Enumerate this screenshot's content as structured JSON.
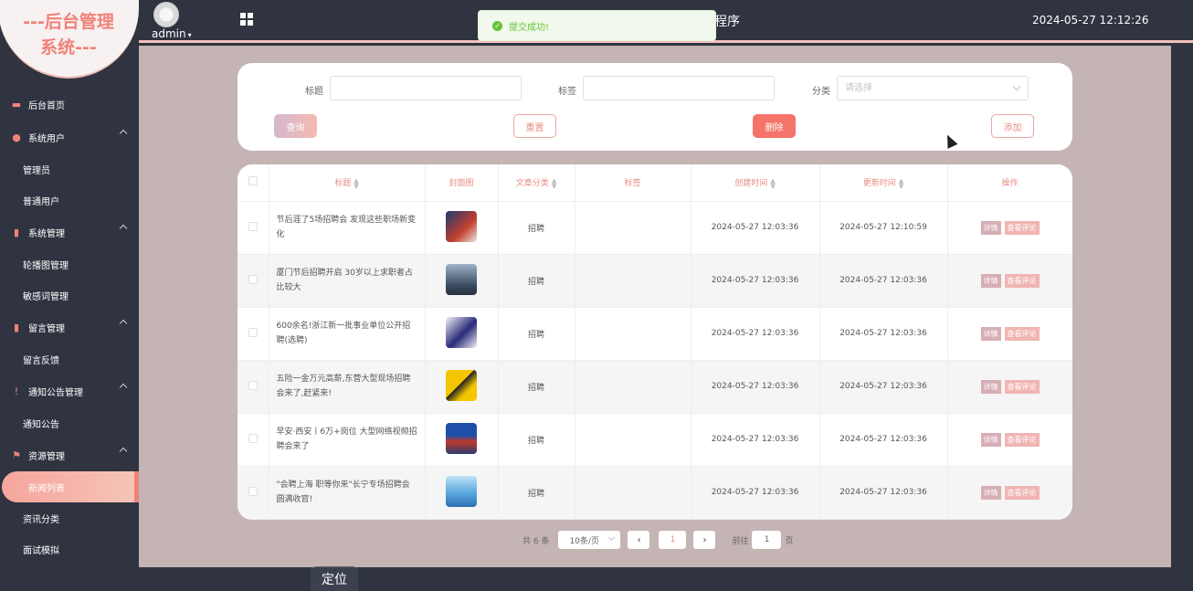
{
  "sidebar": {
    "brand_line1": "---后台管理",
    "brand_line2": "系统---",
    "menu": {
      "home": "后台首页",
      "users": "系统用户",
      "admin": "管理员",
      "normal_users": "普通用户",
      "system": "系统管理",
      "carousel": "轮播图管理",
      "sensitive": "敏感词管理",
      "messages": "留言管理",
      "feedback": "留言反馈",
      "notices": "通知公告管理",
      "notice": "通知公告",
      "resources": "资源管理",
      "news_list": "新闻列表",
      "news_category": "资讯分类",
      "interview": "面试模拟"
    }
  },
  "header": {
    "user": "admin",
    "app_title": "程序",
    "clock": "2024-05-27 12:12:26"
  },
  "toast": {
    "message": "提交成功!"
  },
  "search": {
    "title_label": "标题",
    "tag_label": "标签",
    "category_label": "分类",
    "category_placeholder": "请选择",
    "btn_query": "查询",
    "btn_reset": "重置",
    "btn_delete": "删除",
    "btn_add": "添加"
  },
  "table": {
    "headers": {
      "title": "标题",
      "cover": "封面图",
      "category": "文章分类",
      "tag": "标签",
      "created": "创建时间",
      "updated": "更新时间",
      "actions": "操作"
    },
    "action_detail": "详情",
    "action_comment": "查看评论",
    "rows": [
      {
        "title": "节后涯了5场招聘会 发现这些职场新变化",
        "category": "招聘",
        "tag": "",
        "created": "2024-05-27 12:03:36",
        "updated": "2024-05-27 12:10:59"
      },
      {
        "title": "厦门节后招聘开启 30岁以上求职者占比较大",
        "category": "招聘",
        "tag": "",
        "created": "2024-05-27 12:03:36",
        "updated": "2024-05-27 12:03:36"
      },
      {
        "title": "600余名!浙江新一批事业单位公开招聘(选聘)",
        "category": "招聘",
        "tag": "",
        "created": "2024-05-27 12:03:36",
        "updated": "2024-05-27 12:03:36"
      },
      {
        "title": "五险一金万元高薪,东营大型现场招聘会来了,赶紧来!",
        "category": "招聘",
        "tag": "",
        "created": "2024-05-27 12:03:36",
        "updated": "2024-05-27 12:03:36"
      },
      {
        "title": "早安·西安丨6万+岗位 大型网络视频招聘会来了",
        "category": "招聘",
        "tag": "",
        "created": "2024-05-27 12:03:36",
        "updated": "2024-05-27 12:03:36"
      },
      {
        "title": "\"会聘上海 职等你来\"长宁专场招聘会圆满收官!",
        "category": "招聘",
        "tag": "",
        "created": "2024-05-27 12:03:36",
        "updated": "2024-05-27 12:03:36"
      }
    ]
  },
  "pager": {
    "total": "共 6 条",
    "page_size": "10条/页",
    "current": "1",
    "goto_label": "前往",
    "goto_value": "1",
    "page_suffix": "页"
  },
  "footer_tab": "定位",
  "colors": {
    "accent": "#f08278",
    "sidebar": "#2f3440",
    "main_bg": "#c4b4b4",
    "success": "#67c23a"
  }
}
